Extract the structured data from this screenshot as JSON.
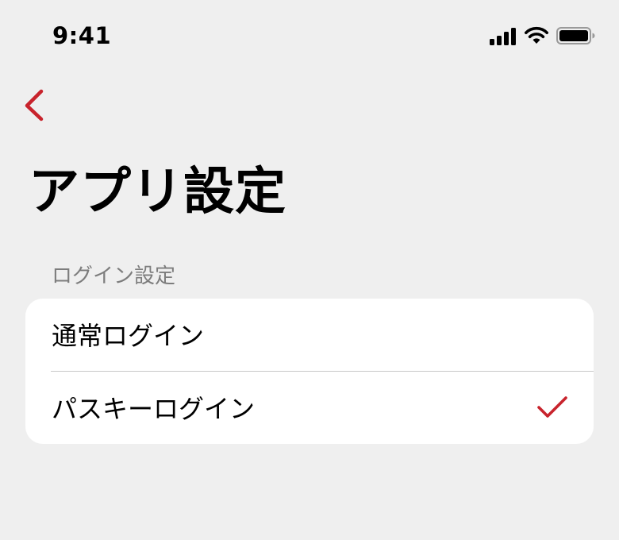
{
  "status_bar": {
    "time": "9:41",
    "icons": [
      "signal-icon",
      "wifi-icon",
      "battery-icon"
    ]
  },
  "navigation": {
    "back_icon": "chevron-left-icon"
  },
  "page": {
    "title": "アプリ設定"
  },
  "login_section": {
    "header": "ログイン設定",
    "options": [
      {
        "label": "通常ログイン",
        "selected": false
      },
      {
        "label": "パスキーログイン",
        "selected": true
      }
    ]
  },
  "colors": {
    "background": "#efefef",
    "card": "#ffffff",
    "accent": "#c8232c",
    "section_header_text": "#7d7d7d",
    "divider": "#c8c8c8"
  }
}
